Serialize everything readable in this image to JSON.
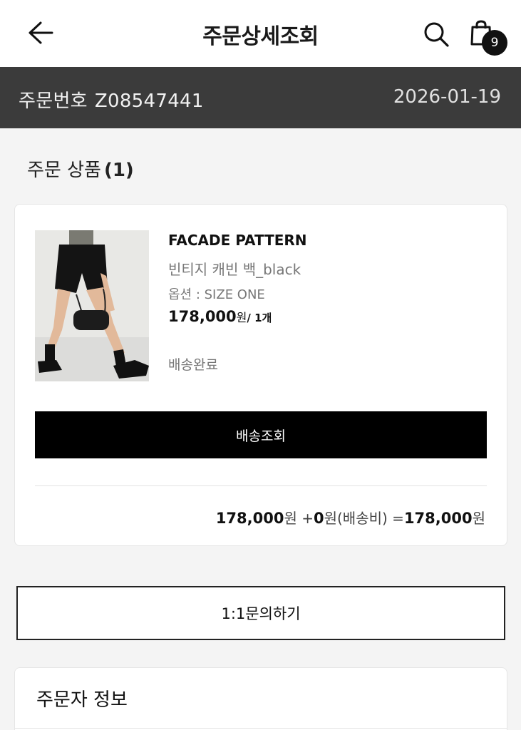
{
  "header": {
    "title": "주문상세조회",
    "back_icon": "arrow-left-icon",
    "search_icon": "search-icon",
    "cart_icon": "shopping-bag-icon",
    "cart_count": "9"
  },
  "order": {
    "label": "주문번호",
    "number": "Z08547441",
    "date": "2026-01-19"
  },
  "section": {
    "title": "주문 상품",
    "count": "(1)"
  },
  "product": {
    "brand": "FACADE PATTERN",
    "name": "빈티지 캐빈 백_black",
    "option": "옵션 : SIZE ONE",
    "price": "178,000",
    "price_unit": "원",
    "quantity": "/ 1개",
    "status": "배송완료",
    "track_button": "배송조회"
  },
  "total": {
    "product_amount": "178,000",
    "unit1": "원 +",
    "shipping_amount": "0",
    "unit2": "원(배송비) =",
    "grand_total": "178,000",
    "unit3": "원"
  },
  "inquiry_button": "1:1문의하기",
  "orderer": {
    "title": "주문자 정보"
  },
  "colors": {
    "order_bar": "#3b3b3b",
    "primary_button": "#000000",
    "badge": "#111111"
  }
}
